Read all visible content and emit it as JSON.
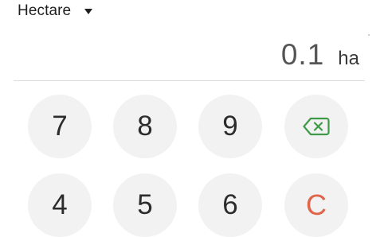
{
  "unit_selector": {
    "label": "Hectare",
    "icon": "caret-down-icon"
  },
  "display": {
    "value": "0.1",
    "unit": "ha"
  },
  "keypad": {
    "keys": {
      "seven": "7",
      "eight": "8",
      "nine": "9",
      "four": "4",
      "five": "5",
      "six": "6",
      "clear": "C"
    },
    "backspace_icon": "backspace-icon"
  },
  "colors": {
    "key_background": "#f2f2f2",
    "backspace_accent": "#3f9a48",
    "clear_accent": "#e0644a",
    "divider": "#dcdcdc"
  }
}
